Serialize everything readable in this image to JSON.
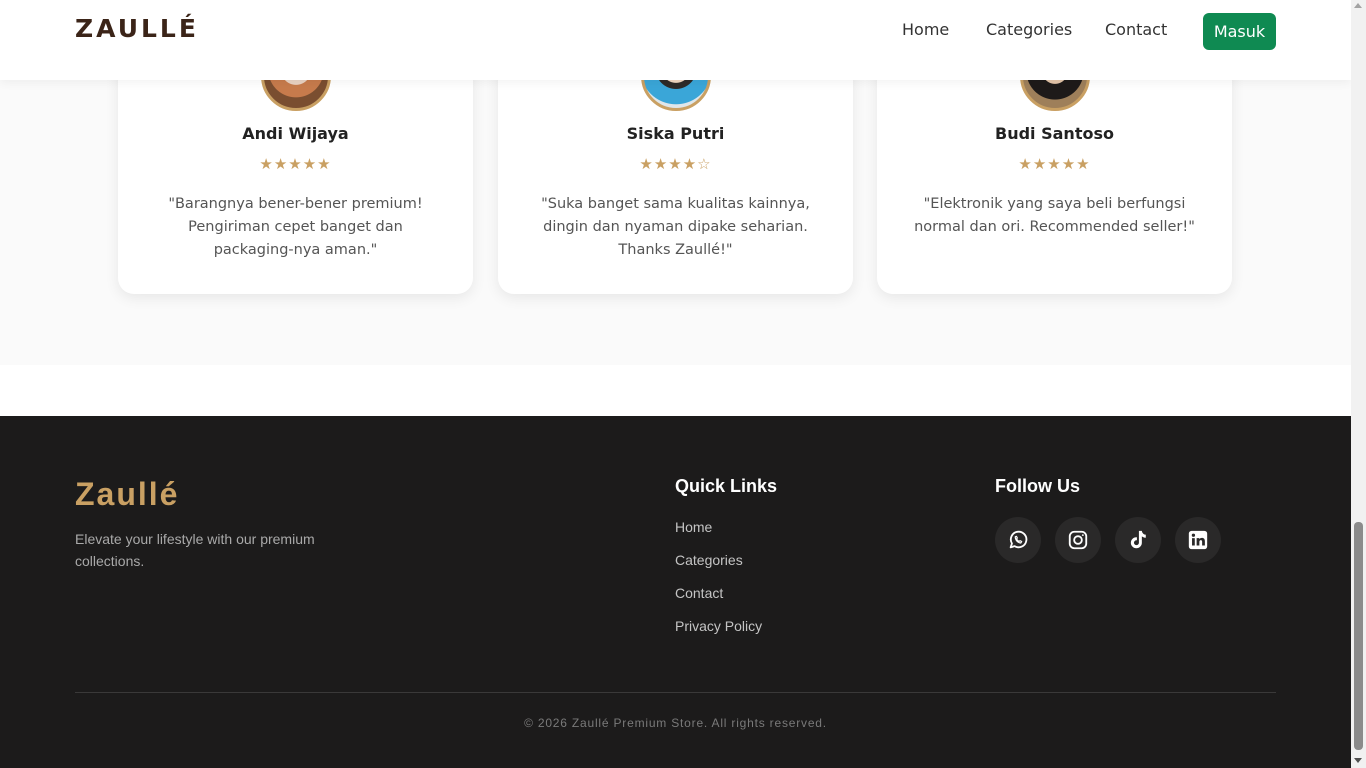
{
  "header": {
    "logo": "ZAULLÉ",
    "nav": [
      "Home",
      "Categories",
      "Contact"
    ],
    "login_label": "Masuk",
    "login_color": "#0f8a52"
  },
  "testimonials": [
    {
      "name": "Andi Wijaya",
      "rating": 5,
      "stars": "★★★★★",
      "quote": "\"Barangnya bener-bener premium! Pengiriman cepet banget dan packaging-nya aman.\""
    },
    {
      "name": "Siska Putri",
      "rating": 4,
      "stars": "★★★★☆",
      "quote": "\"Suka banget sama kualitas kainnya, dingin dan nyaman dipake seharian. Thanks Zaullé!\""
    },
    {
      "name": "Budi Santoso",
      "rating": 5,
      "stars": "★★★★★",
      "quote": "\"Elektronik yang saya beli berfungsi normal dan ori. Recommended seller!\""
    }
  ],
  "footer": {
    "brand": "Zaullé",
    "tagline": "Elevate your lifestyle with our premium collections.",
    "quick_links_title": "Quick Links",
    "quick_links": [
      "Home",
      "Categories",
      "Contact",
      "Privacy Policy"
    ],
    "follow_title": "Follow Us",
    "social": [
      "whatsapp-icon",
      "instagram-icon",
      "tiktok-icon",
      "linkedin-icon"
    ],
    "copyright": "© 2026 Zaullé Premium Store. All rights reserved."
  },
  "colors": {
    "accent_gold": "#c9a063",
    "footer_bg": "#1c1b1b",
    "logo_brown": "#3b2418"
  }
}
